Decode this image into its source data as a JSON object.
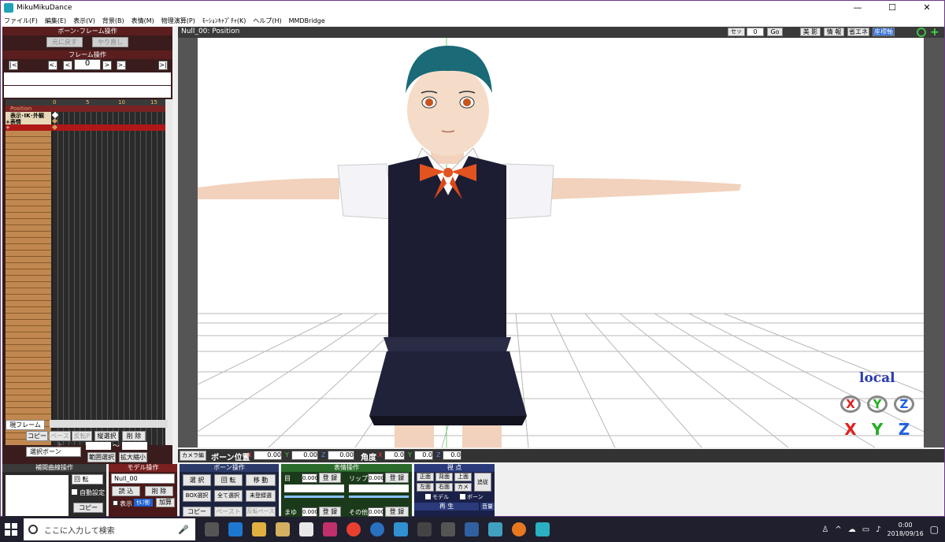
{
  "app": {
    "title": "MikuMikuDance",
    "win_min": "—",
    "win_max": "☐",
    "win_close": "✕"
  },
  "menu": [
    "ファイル(F)",
    "編集(E)",
    "表示(V)",
    "背景(B)",
    "表情(M)",
    "物理演算(P)",
    "ﾓｰｼｮﾝｷｬﾌﾟﾁｬ(K)",
    "ヘルプ(H)",
    "MMDBridge"
  ],
  "bone_frame": {
    "header": "ボーン･フレーム操作",
    "undo": "元に戻す",
    "redo": "やり直し"
  },
  "frame_ops": {
    "header": "フレーム操作",
    "first": "|<",
    "prev_key": "<.",
    "prev": "<",
    "frame_value": "0",
    "next": ">",
    "next_key": ">.",
    "last": ">|"
  },
  "timeline": {
    "ticks": [
      "0",
      "5",
      "10",
      "15"
    ],
    "rows": [
      {
        "label": "Position",
        "selected": true
      },
      {
        "label": "表示･IK･外観",
        "selected": false
      },
      {
        "label": "+表情",
        "selected": false
      },
      {
        "label": "+",
        "selected": true
      }
    ]
  },
  "left_controls": {
    "current_frame": "現フレーム",
    "copy": "コピー",
    "paste": "ペースト",
    "reverse_paste": "反転P",
    "vertical_select": "縦選択",
    "delete": "削 除",
    "select_bone": "選択ボーン",
    "tilde": "～",
    "range_select": "範囲選択",
    "zoom": "拡大縮小"
  },
  "viewport": {
    "title": "Null_00: Position",
    "set_label": "セット",
    "set_value": "0",
    "go": "Go",
    "btn_beauty": "美 影",
    "btn_info": "情 報",
    "btn_eco": "省エネ",
    "btn_axis": "座標軸",
    "local_label": "local",
    "axis_x": "X",
    "axis_y": "Y",
    "axis_z": "Z"
  },
  "bottom_bar": {
    "camera_edit": "カメラ編",
    "bone_pos": "ボーン位置",
    "x": "X",
    "y": "Y",
    "z": "Z",
    "pos_x": "0.00",
    "pos_y": "0.00",
    "pos_z": "0.00",
    "angle": "角度",
    "ang_x": "0.0",
    "ang_y": "0.0",
    "ang_z": "0.0"
  },
  "panels": {
    "interp": {
      "header": "補間曲線操作",
      "rotate": "回 転",
      "auto": "自動設定",
      "copy": "コピー"
    },
    "model": {
      "header": "モデル操作",
      "model_name": "Null_00",
      "load": "読 込",
      "delete": "削 除",
      "show": "表示",
      "self_shadow": "ｾﾙﾌ影",
      "add": "加算"
    },
    "bone": {
      "header": "ボーン操作",
      "select": "選 択",
      "rotate": "回 転",
      "move": "移 動",
      "box_select": "BOX選択",
      "select_all": "全て選択",
      "unregistered": "未登録選",
      "copy": "コピー",
      "paste": "ペースト",
      "reverse_paste": "反転ペースト"
    },
    "expression": {
      "header": "表情操作",
      "eye": "目",
      "eye_val": "0.000",
      "register": "登 録",
      "lip": "リップ",
      "lip_val": "0.000",
      "brow": "まゆ",
      "brow_val": "0.000",
      "other": "その他",
      "other_val": "0.000"
    },
    "view": {
      "header": "視 点",
      "front": "正面",
      "back": "背面",
      "top": "上面",
      "follow": "追従",
      "left": "左面",
      "right": "右面",
      "camera": "カメラ",
      "model": "モデル",
      "bone": "ボーン",
      "play_header": "再 生",
      "volume": "音量"
    }
  },
  "taskbar": {
    "search_placeholder": "ここに入力して検索",
    "time": "0:00",
    "date": "2018/09/16"
  }
}
